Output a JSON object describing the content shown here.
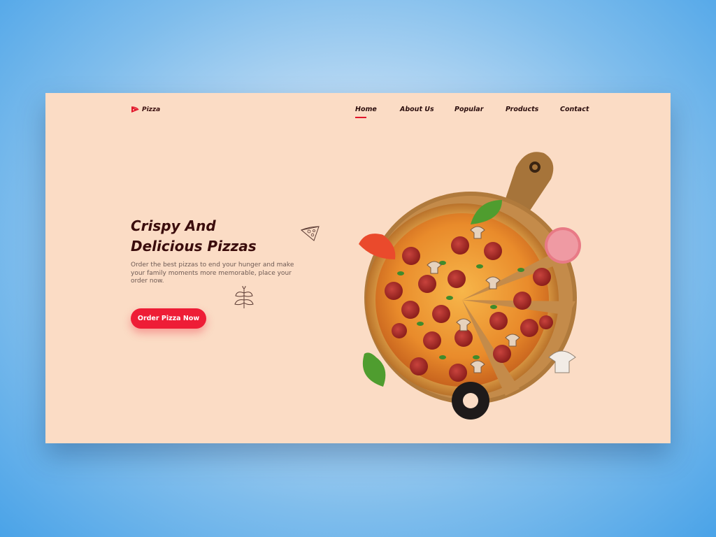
{
  "brand": {
    "name": "Pizza"
  },
  "nav": {
    "items": [
      "Home",
      "About Us",
      "Popular",
      "Products",
      "Contact"
    ],
    "active": "Home"
  },
  "hero": {
    "title_line1": "Crispy And",
    "title_line2": "Delicious Pizzas",
    "description": "Order the best pizzas to end your hunger and make your family moments more memorable, place your order now.",
    "cta_label": "Order Pizza Now"
  },
  "colors": {
    "accent": "#ee1d36",
    "card_bg": "#fbdcc5",
    "heading": "#3a0c0c",
    "page_bg": "#4aa3e8"
  },
  "icons": [
    "pizza-logo-icon",
    "pizza-slice-doodle-icon",
    "leaf-doodle-icon"
  ]
}
